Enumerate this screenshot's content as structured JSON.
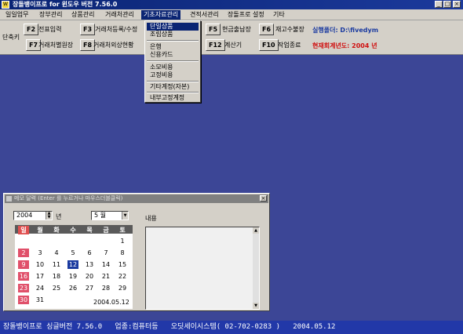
{
  "window": {
    "title": "장돌뱅이프로 for 윈도우 버전 7.56.0",
    "icon_text": "W"
  },
  "menu": [
    "일일업무",
    "장부관리",
    "상품관리",
    "거래처관리",
    "기초자료관리",
    "견적서관리",
    "장돌프로 설정",
    "기타"
  ],
  "toolbar": {
    "side_label": "단축키",
    "row1": [
      {
        "key": "F2",
        "label": "전표입력"
      },
      {
        "key": "F3",
        "label": "거래처등록/수정"
      },
      {
        "key": "F5",
        "label": "현금출납장"
      },
      {
        "key": "F6",
        "label": "재고수불장"
      }
    ],
    "row2": [
      {
        "key": "F7",
        "label": "거래처별원장"
      },
      {
        "key": "F8",
        "label": "거래처외상현황"
      },
      {
        "key": "F12",
        "label": "계산기"
      },
      {
        "key": "F10",
        "label": "작업종료"
      }
    ],
    "info_folder": "실행폴더: D:\\fivedym",
    "info_year": "현재회계년도: 2004 년"
  },
  "dropdown": {
    "items": [
      "단일상품",
      "조립상품",
      "은행",
      "신용카드",
      "소모비용",
      "고정비용",
      "기타계정(자본)",
      "내부고정계정"
    ]
  },
  "memo": {
    "title": "메모 달력 (Enter 를 누르거나 마우스더블클릭)",
    "year": "2004",
    "year_suffix": "년",
    "month": "5 월",
    "weekdays": [
      "일",
      "월",
      "화",
      "수",
      "목",
      "금",
      "토"
    ],
    "weeks": [
      [
        "",
        "",
        "",
        "",
        "",
        "",
        "1"
      ],
      [
        "2",
        "3",
        "4",
        "5",
        "6",
        "7",
        "8"
      ],
      [
        "9",
        "10",
        "11",
        "12",
        "13",
        "14",
        "15"
      ],
      [
        "16",
        "17",
        "18",
        "19",
        "20",
        "21",
        "22"
      ],
      [
        "23",
        "24",
        "25",
        "26",
        "27",
        "28",
        "29"
      ],
      [
        "30",
        "31",
        "",
        "",
        "",
        "",
        ""
      ]
    ],
    "today": "12",
    "date_text": "2004.05.12",
    "content_label": "내용"
  },
  "status": {
    "text": "장돌뱅이프로 싱글버전 7.56.0   업종:컴퓨터등   오딧세이시스템( 02-702-0283 )   2004.05.12"
  }
}
